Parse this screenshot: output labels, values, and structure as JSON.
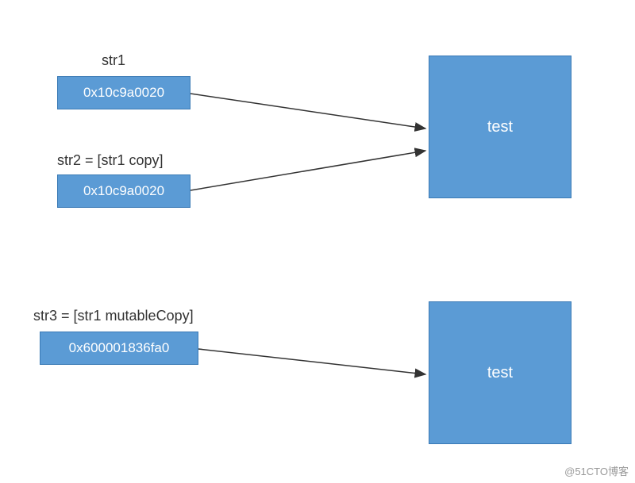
{
  "labels": {
    "str1": "str1",
    "str2": "str2 = [str1 copy]",
    "str3": "str3 = [str1 mutableCopy]"
  },
  "boxes": {
    "addr1": "0x10c9a0020",
    "addr2": "0x10c9a0020",
    "addr3": "0x600001836fa0",
    "target1": "test",
    "target2": "test"
  },
  "watermark": "@51CTO博客"
}
